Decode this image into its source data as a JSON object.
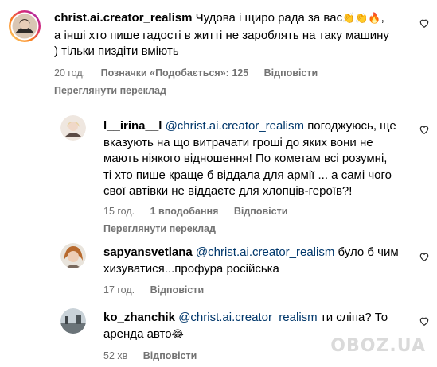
{
  "comment_main": {
    "username": "christ.ai.creator_realism",
    "text_line1": "Чудова і щиро рада за вас",
    "emoji_line1": "👏👏🔥",
    "text_line1_end": ",",
    "text_line2": "а інші хто пише гадості в житті не зароблять на таку машину",
    "text_line3": ") тільки пиздіти вміють",
    "time": "20 год.",
    "likes": "Позначки «Подобається»: 125",
    "reply_label": "Відповісти",
    "see_translation": "Переглянути переклад"
  },
  "replies": [
    {
      "username": "l__irina__l",
      "mention": "@christ.ai.creator_realism",
      "text_line1": "погоджуюсь, ще",
      "text_line2": "вказують на що витрачати гроші до яких вони не",
      "text_line3": "мають ніякого відношення! По кометам всі розумні,",
      "text_line4": "ті хто пише краще б віддала для армії ... а самі чого",
      "text_line5": "свої автівки не віддаєте для хлопців-героїв?!",
      "time": "15 год.",
      "likes": "1 вподобання",
      "reply_label": "Відповісти",
      "see_translation": "Переглянути переклад"
    },
    {
      "username": "sapyansvetlana",
      "mention": "@christ.ai.creator_realism",
      "text_line1": "було б чим",
      "text_line2": "хизуватися...профура російська",
      "time": "17 год.",
      "reply_label": "Відповісти"
    },
    {
      "username": "ko_zhanchik",
      "mention": "@christ.ai.creator_realism",
      "text_line1": "ти сліпа? То",
      "text_line2": "аренда авто",
      "emoji": "😂",
      "time": "52 хв",
      "reply_label": "Відповісти"
    }
  ],
  "watermark": "OBOZ.UA",
  "icons": {
    "like": "heart-outline-icon"
  },
  "colors": {
    "mention": "#00376b",
    "meta": "#737373",
    "avatar_ring": "#d6249f"
  }
}
